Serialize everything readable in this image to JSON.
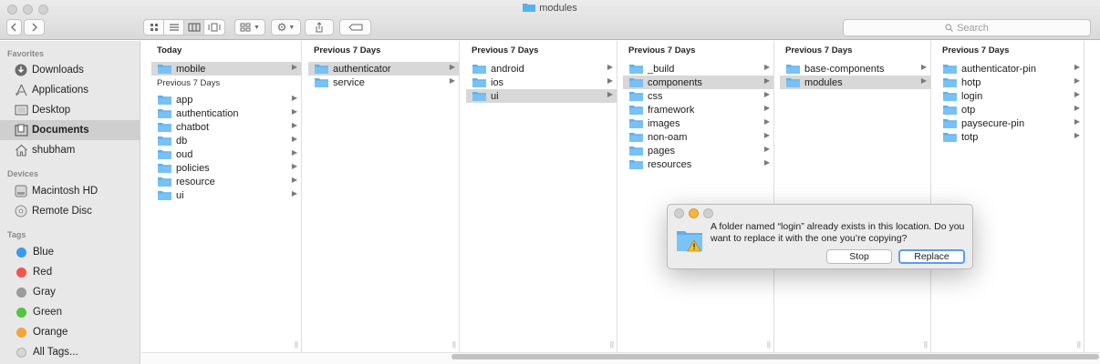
{
  "window": {
    "title": "modules",
    "search_placeholder": "Search"
  },
  "toolbar": {
    "back_icon": "chevron-left",
    "forward_icon": "chevron-right",
    "view_modes": [
      "icon-view",
      "list-view",
      "column-view",
      "cover-flow-view"
    ],
    "active_view": "column-view"
  },
  "sidebar": {
    "favorites_label": "Favorites",
    "favorites": [
      {
        "label": "Downloads",
        "icon": "download-icon"
      },
      {
        "label": "Applications",
        "icon": "applications-icon"
      },
      {
        "label": "Desktop",
        "icon": "desktop-icon"
      },
      {
        "label": "Documents",
        "icon": "documents-icon",
        "selected": true
      },
      {
        "label": "shubham",
        "icon": "home-icon"
      }
    ],
    "devices_label": "Devices",
    "devices": [
      {
        "label": "Macintosh HD",
        "icon": "hard-drive-icon"
      },
      {
        "label": "Remote Disc",
        "icon": "disc-icon"
      }
    ],
    "tags_label": "Tags",
    "tags": [
      {
        "label": "Blue",
        "color": "#3b99f0"
      },
      {
        "label": "Red",
        "color": "#f2544e"
      },
      {
        "label": "Gray",
        "color": "#9b9b9b"
      },
      {
        "label": "Green",
        "color": "#52c63e"
      },
      {
        "label": "Orange",
        "color": "#f5a33a"
      },
      {
        "label": "All Tags...",
        "color": "#d6d6d6"
      }
    ]
  },
  "columns": [
    {
      "header": "Today",
      "items": [
        {
          "label": "mobile",
          "selected": true
        }
      ],
      "subheader": "Previous 7 Days",
      "subitems": [
        {
          "label": "app"
        },
        {
          "label": "authentication"
        },
        {
          "label": "chatbot"
        },
        {
          "label": "db"
        },
        {
          "label": "oud"
        },
        {
          "label": "policies"
        },
        {
          "label": "resource"
        },
        {
          "label": "ui"
        }
      ]
    },
    {
      "header": "Previous 7 Days",
      "items": [
        {
          "label": "authenticator",
          "selected": true
        },
        {
          "label": "service"
        }
      ]
    },
    {
      "header": "Previous 7 Days",
      "items": [
        {
          "label": "android"
        },
        {
          "label": "ios"
        },
        {
          "label": "ui",
          "selected": true
        }
      ]
    },
    {
      "header": "Previous 7 Days",
      "items": [
        {
          "label": "_build"
        },
        {
          "label": "components",
          "selected": true
        },
        {
          "label": "css"
        },
        {
          "label": "framework"
        },
        {
          "label": "images"
        },
        {
          "label": "non-oam"
        },
        {
          "label": "pages"
        },
        {
          "label": "resources"
        }
      ]
    },
    {
      "header": "Previous 7 Days",
      "items": [
        {
          "label": "base-components"
        },
        {
          "label": "modules",
          "selected": true
        }
      ]
    },
    {
      "header": "Previous 7 Days",
      "items": [
        {
          "label": "authenticator-pin"
        },
        {
          "label": "hotp"
        },
        {
          "label": "login"
        },
        {
          "label": "otp"
        },
        {
          "label": "paysecure-pin"
        },
        {
          "label": "totp"
        }
      ]
    }
  ],
  "dialog": {
    "message": "A folder named “login” already exists in this location. Do you want to replace it with the one you’re copying?",
    "stop_label": "Stop",
    "replace_label": "Replace"
  },
  "colors": {
    "folder": "#5ab1f1",
    "selection": "#d8d8d8",
    "default_button_ring": "#5b9bf1"
  }
}
